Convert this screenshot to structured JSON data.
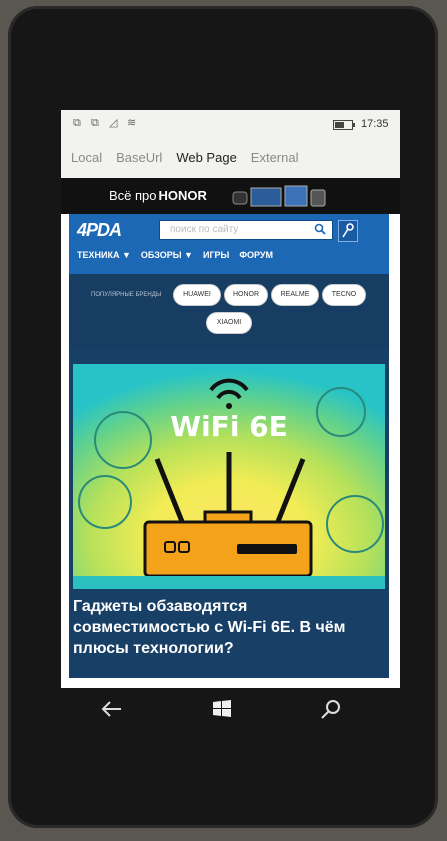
{
  "status": {
    "time": "17:35",
    "battery_level": 0.55
  },
  "tabs": [
    {
      "label": "Local"
    },
    {
      "label": "BaseUrl"
    },
    {
      "label": "Web Page",
      "active": true
    },
    {
      "label": "External"
    }
  ],
  "banner": {
    "prefix": "Всё про",
    "brand": "HONOR"
  },
  "site": {
    "logo": "4PDA",
    "search_placeholder": "поиск по сайту",
    "nav": [
      "ТЕХНИКА ▼",
      "ОБЗОРЫ ▼",
      "ИГРЫ",
      "ФОРУМ"
    ]
  },
  "brands": {
    "label": "ПОПУЛЯРНЫЕ БРЕНДЫ",
    "items": [
      "HUAWEI",
      "HONOR",
      "REALME",
      "TECNO",
      "XIAOMI"
    ]
  },
  "article": {
    "image_text": "WiFi 6E",
    "title": "Гаджеты обзаводятся совместимостью с Wi-Fi 6E. В чём плюсы технологии?"
  },
  "colors": {
    "site_blue": "#1d68b5",
    "dark_navy": "#183f66",
    "router_orange": "#f5a21b"
  }
}
